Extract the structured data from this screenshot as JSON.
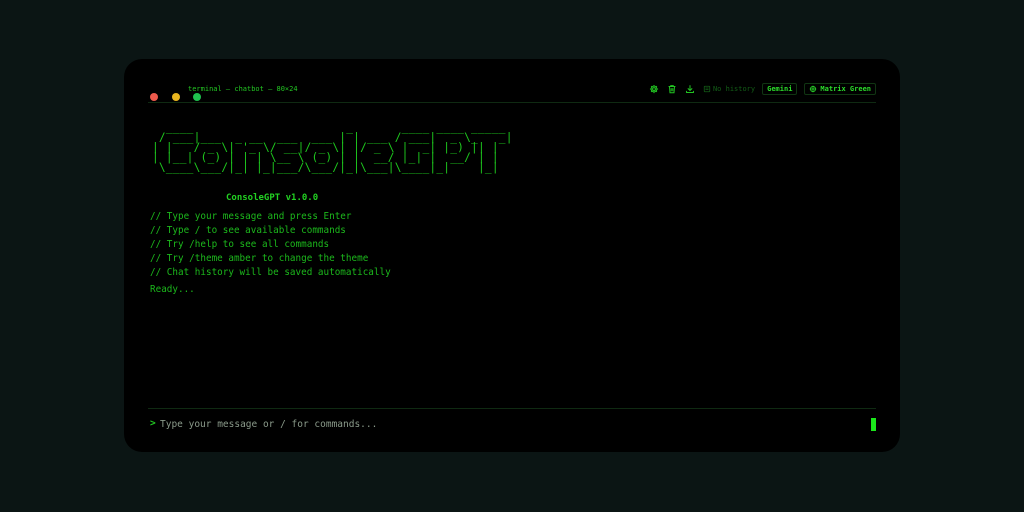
{
  "window": {
    "title": "terminal — chatbot — 80×24",
    "traffic_lights": [
      "close",
      "minimize",
      "maximize"
    ]
  },
  "toolbar": {
    "icons": [
      "settings-icon",
      "trash-icon",
      "download-icon"
    ],
    "history_label": "No history",
    "model_label": "Gemini",
    "theme_label": "Matrix Green"
  },
  "banner": {
    "ascii_art": "  ____                      _       ____ ____ _____\n / ___|___  _ __  ___  ___ | | ___ / ___|  _ \\_   _|\n| |   / _ \\| '_ \\/ __|/ _ \\| |/ _ \\ |  _| |_) || |\n| |__| (_) | | | \\__ \\ (_) | |  __/ |_| |  __/ | |\n \\____\\___/|_| |_|___/\\___/|_|\\___|\\____|_|    |_|",
    "version": "ConsoleGPT v1.0.0"
  },
  "help_lines": [
    "// Type your message and press Enter",
    "// Type / to see available commands",
    "// Try /help to see all commands",
    "// Try /theme amber to change the theme",
    "// Chat history will be saved automatically"
  ],
  "status": "Ready...",
  "input": {
    "prompt": ">",
    "placeholder": "Type your message or / for commands...",
    "value": ""
  },
  "colors": {
    "accent": "#1ec91e",
    "background": "#000000",
    "page_background": "#0b1514"
  }
}
